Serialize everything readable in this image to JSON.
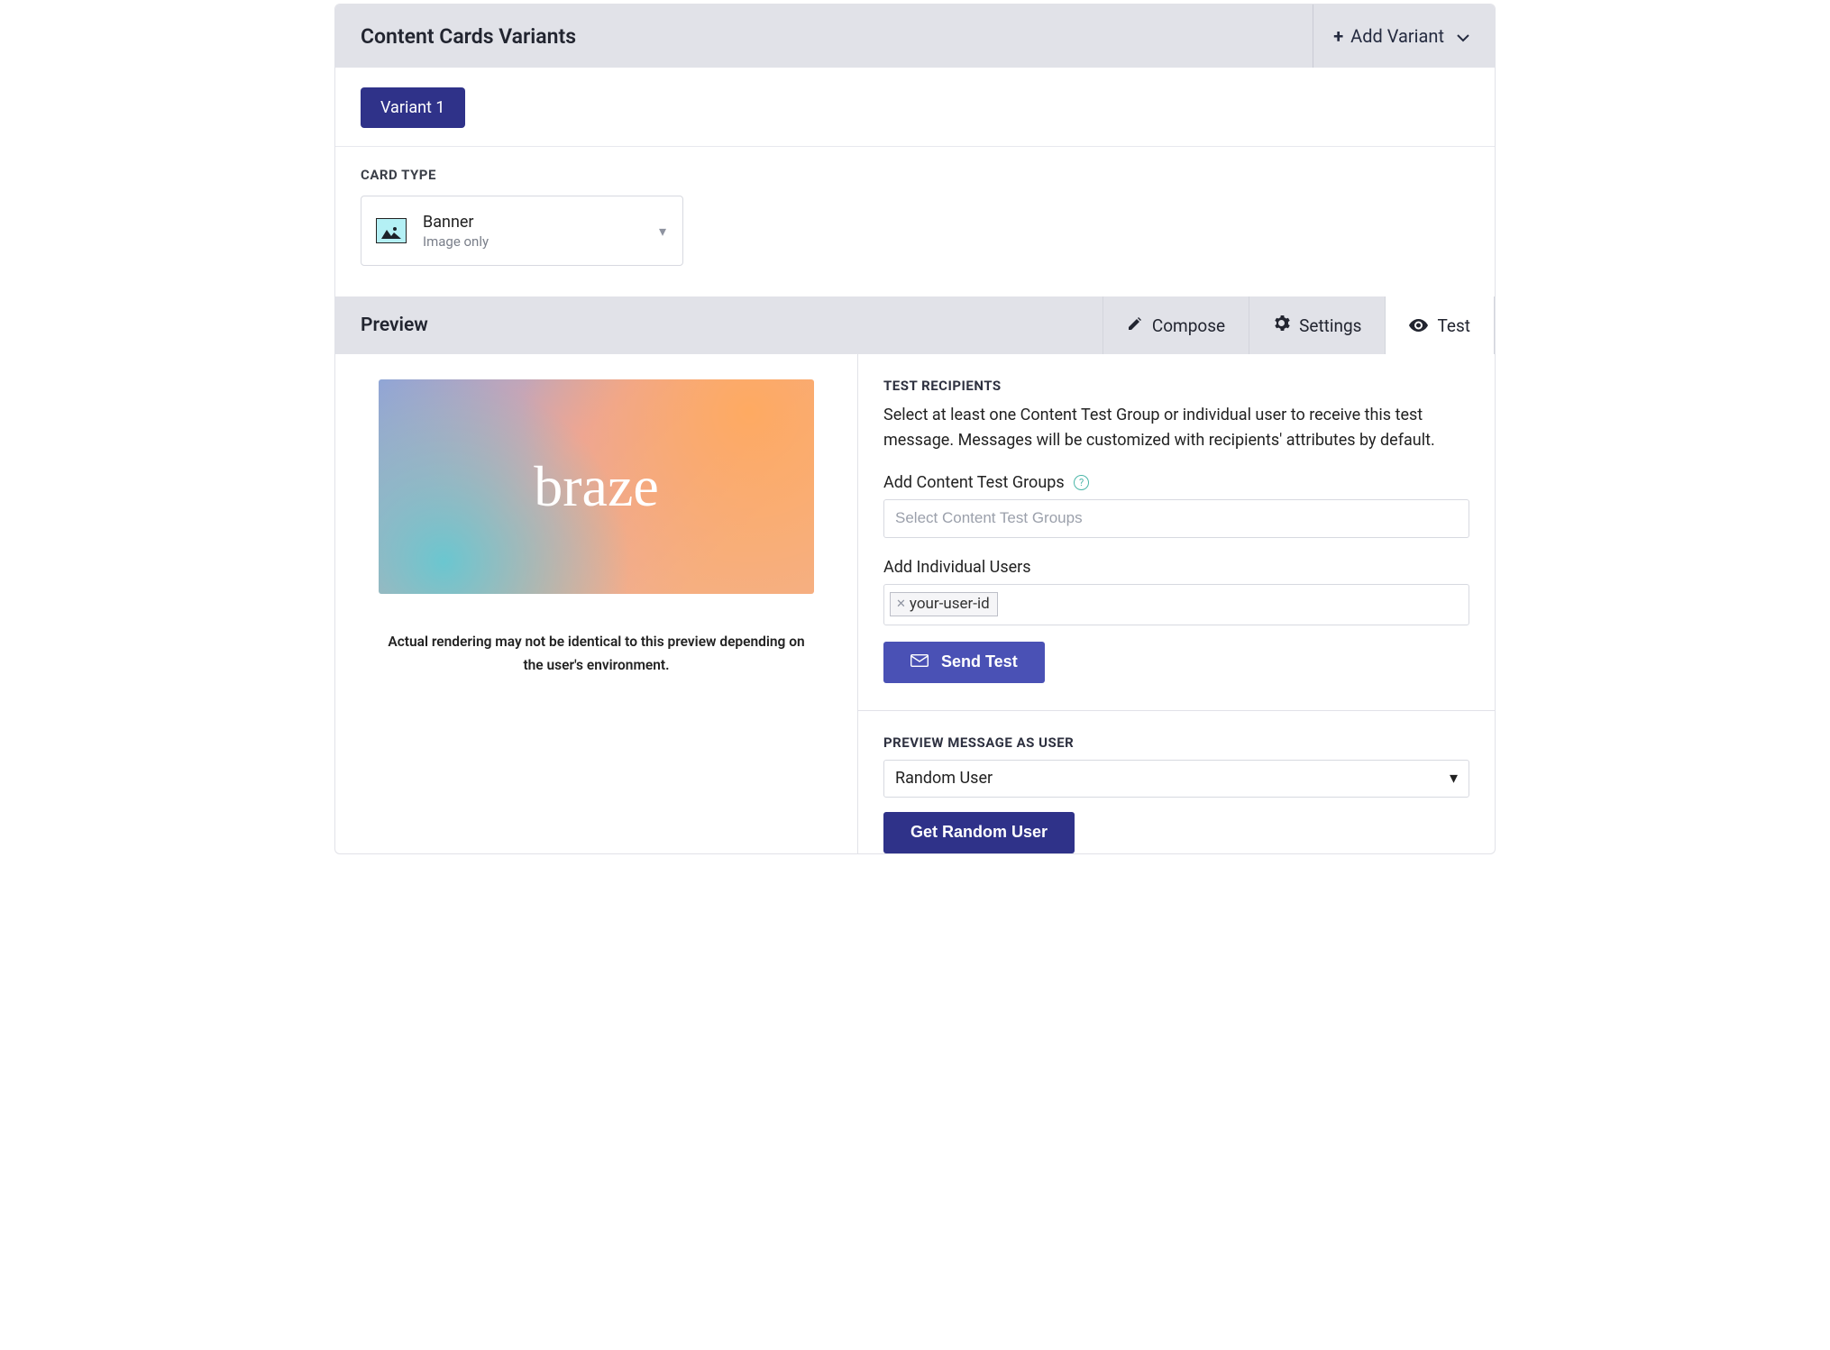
{
  "header": {
    "title": "Content Cards Variants",
    "add_variant": "Add Variant"
  },
  "variants": {
    "tabs": [
      "Variant 1"
    ]
  },
  "card_type": {
    "heading": "CARD TYPE",
    "selected": "Banner",
    "sub": "Image only"
  },
  "preview": {
    "heading": "Preview",
    "banner_text": "braze",
    "caption": "Actual rendering may not be identical to this preview depending on the user's environment."
  },
  "tabs": [
    {
      "label": "Compose",
      "icon": "pencil-icon",
      "active": false
    },
    {
      "label": "Settings",
      "icon": "gear-icon",
      "active": false
    },
    {
      "label": "Test",
      "icon": "eye-icon",
      "active": true
    }
  ],
  "test": {
    "heading": "TEST RECIPIENTS",
    "desc": "Select at least one Content Test Group or individual user to receive this test message. Messages will be customized with recipients' attributes by default.",
    "groups_label": "Add Content Test Groups",
    "groups_placeholder": "Select Content Test Groups",
    "users_label": "Add Individual Users",
    "user_tag": "your-user-id",
    "send_btn": "Send Test"
  },
  "preview_user": {
    "heading": "PREVIEW MESSAGE AS USER",
    "selected": "Random User",
    "btn": "Get Random User"
  },
  "colors": {
    "primary": "#2F3289",
    "primary_light": "#4A51B5",
    "muted_bg": "#E1E2E8",
    "border": "#D7D9E0",
    "text": "#21242B",
    "help_accent": "#4BB6A8"
  }
}
